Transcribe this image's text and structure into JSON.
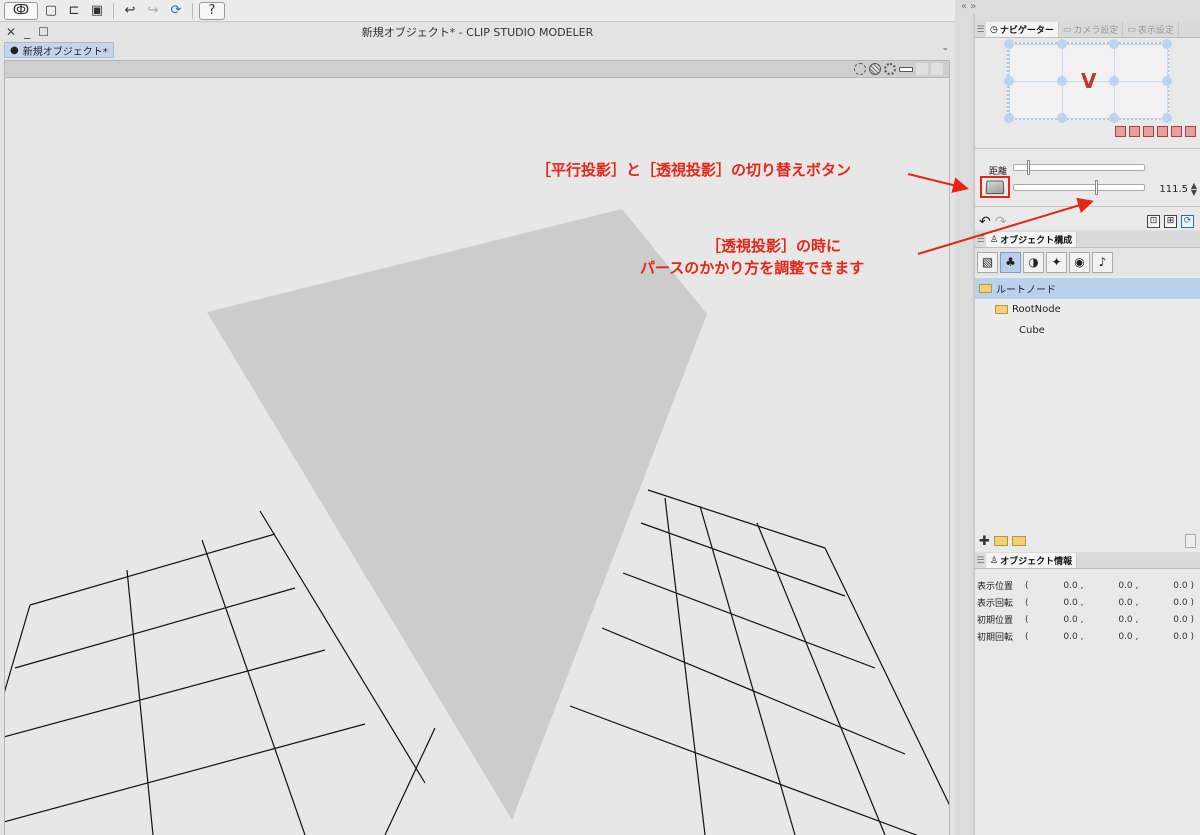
{
  "app": {
    "title": "新規オブジェクト* - CLIP STUDIO MODELER",
    "doc_tab": "新規オブジェクト*"
  },
  "right_panel": {
    "collapse_glyph": "«  »"
  },
  "navigator": {
    "tabs": [
      {
        "label": "ナビゲーター",
        "active": true,
        "icon": "compass-icon"
      },
      {
        "label": "カメラ設定",
        "active": false,
        "icon": "camera-icon"
      },
      {
        "label": "表示設定",
        "active": false,
        "icon": "display-icon"
      }
    ],
    "distance_label": "距離",
    "perspective_value": "111.5",
    "distance_level": 0.1,
    "perspective_level": 0.64
  },
  "object_structure": {
    "tab_label": "オブジェクト構成",
    "tree": [
      {
        "label": "ルートノード",
        "level": 0,
        "selected": true,
        "folder": true
      },
      {
        "label": "RootNode",
        "level": 1,
        "selected": false,
        "folder": true
      },
      {
        "label": "Cube",
        "level": 2,
        "selected": false,
        "folder": false
      }
    ]
  },
  "object_info": {
    "tab_label": "オブジェクト情報",
    "rows": [
      {
        "label": "表示位置",
        "open": "(",
        "x": "0.0 ,",
        "y": "0.0 ,",
        "z": "0.0 )"
      },
      {
        "label": "表示回転",
        "open": "(",
        "x": "0.0 ,",
        "y": "0.0 ,",
        "z": "0.0 )"
      },
      {
        "label": "初期位置",
        "open": "(",
        "x": "0.0 ,",
        "y": "0.0 ,",
        "z": "0.0 )"
      },
      {
        "label": "初期回転",
        "open": "(",
        "x": "0.0 ,",
        "y": "0.0 ,",
        "z": "0.0 )"
      }
    ]
  },
  "annotations": {
    "toggle_note": "［平行投影］と［透視投影］の切り替えボタン",
    "perspective_note_line1": "［透視投影］の時に",
    "perspective_note_line2": "パースのかかり方を調整できます",
    "color": "#e42617"
  }
}
